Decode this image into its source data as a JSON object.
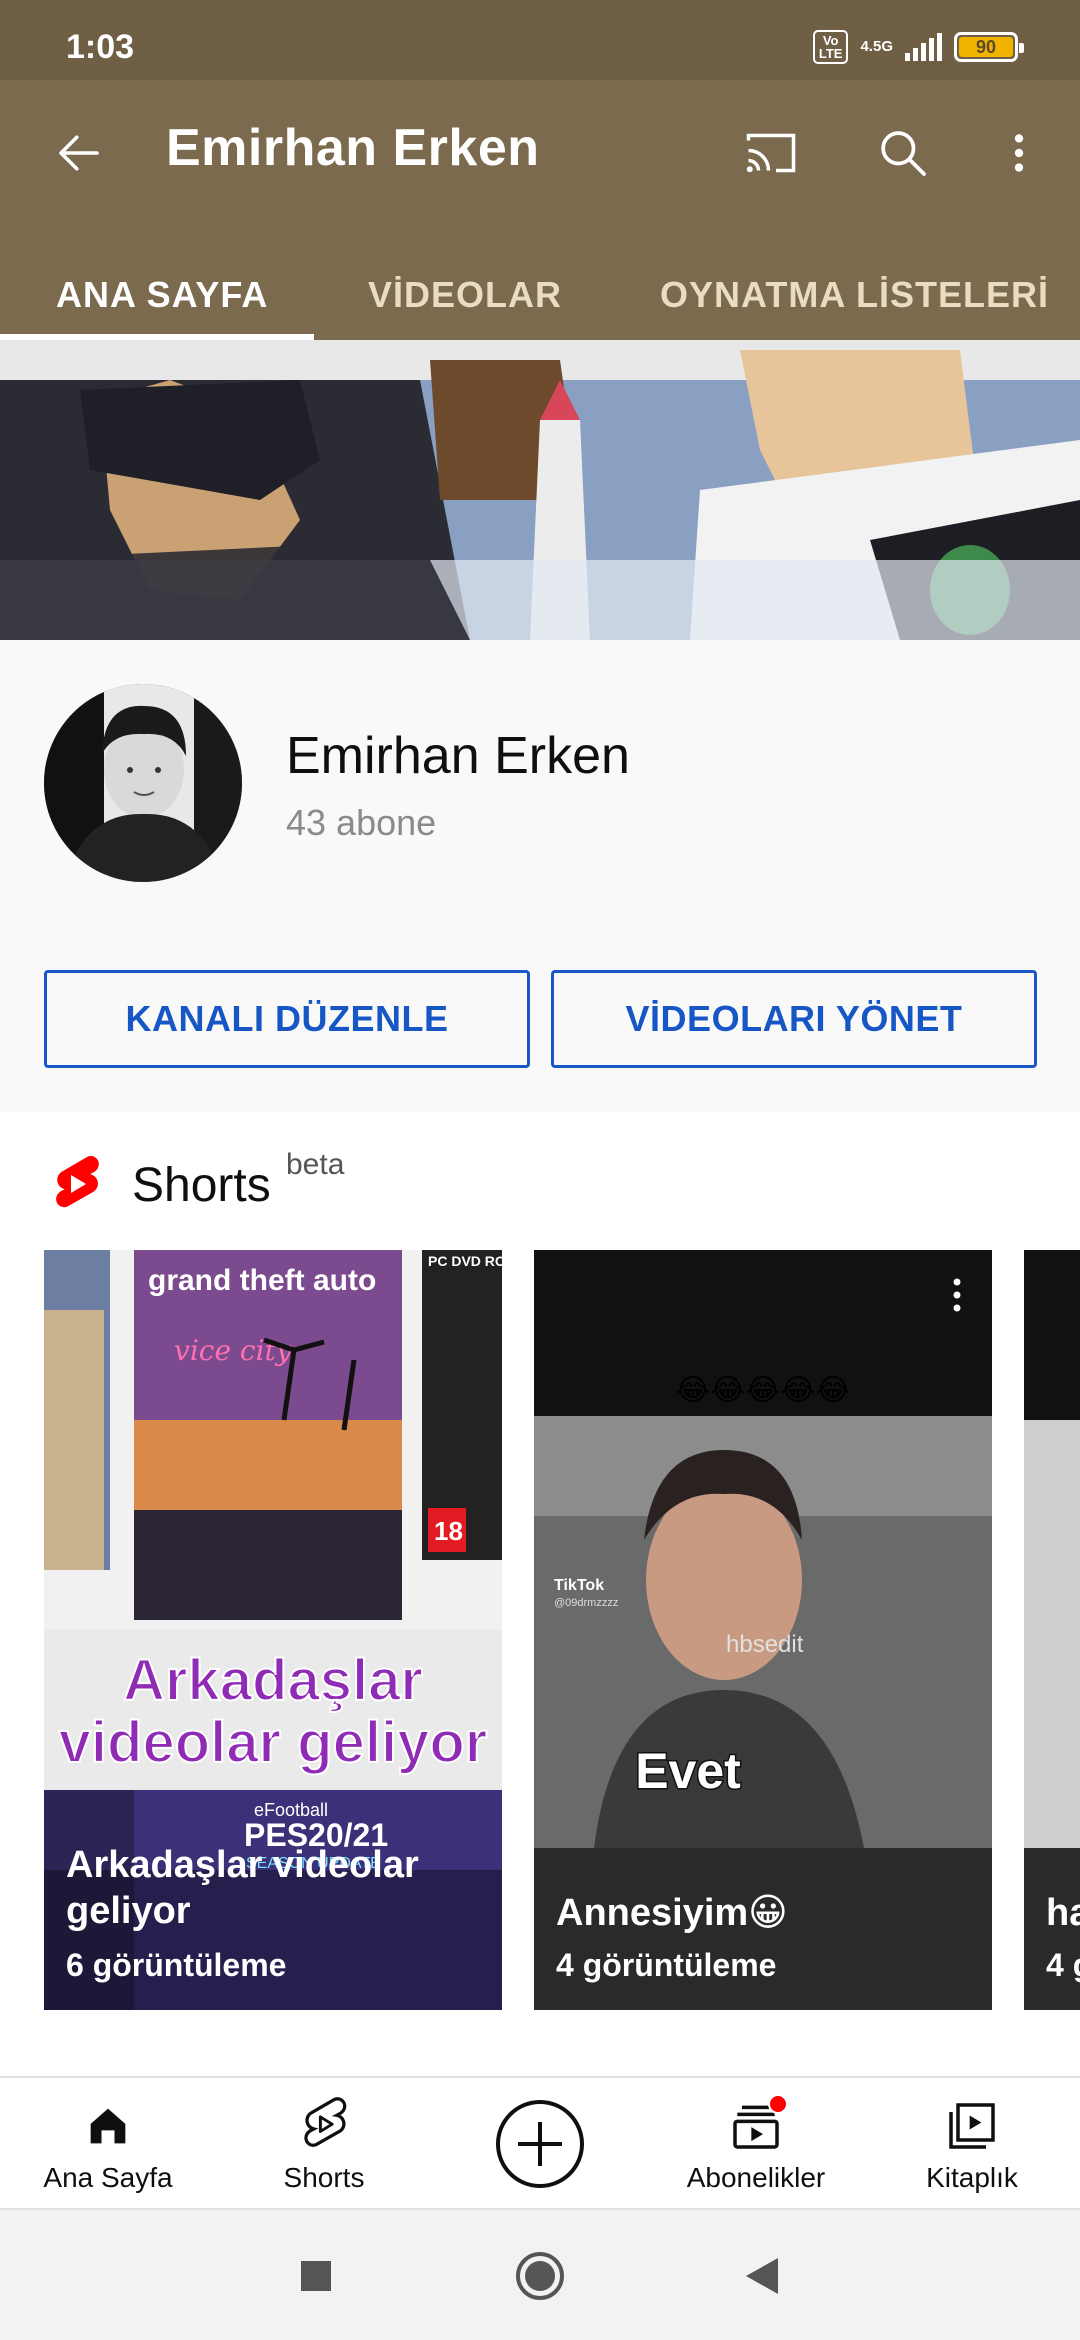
{
  "status_bar": {
    "time": "1:03",
    "volte": "Vo LTE",
    "network": "4.5G",
    "battery": "90"
  },
  "app_bar": {
    "title": "Emirhan Erken",
    "tabs": [
      {
        "label": "ANA SAYFA",
        "active": true
      },
      {
        "label": "VİDEOLAR",
        "active": false
      },
      {
        "label": "OYNATMA LİSTELERİ",
        "active": false
      }
    ]
  },
  "channel": {
    "name": "Emirhan Erken",
    "subscribers": "43 abone",
    "edit_button": "KANALI DÜZENLE",
    "manage_button": "VİDEOLARI YÖNET"
  },
  "shorts": {
    "title": "Shorts",
    "badge": "beta",
    "cards": [
      {
        "title_line1": "Arkadaşlar videolar",
        "title_line2": "geliyor",
        "views": "6 görüntüleme",
        "thumb_text_1": "Arkadaşlar",
        "thumb_text_2": "videolar geliyor",
        "thumb_gta": "grand theft auto",
        "thumb_vice": "vice city",
        "thumb_pes": "PES20/21",
        "thumb_pes_sub": "SEASON UPDATE",
        "thumb_efootball": "eFootball",
        "thumb_rating": "18",
        "thumb_pc": "PC DVD ROM"
      },
      {
        "title": "Annesiyim😀",
        "views": "4 görüntüleme",
        "thumb_emojis": "😂😂😂😂😂",
        "thumb_caption": "Evet",
        "thumb_watermark": "hbsedit",
        "thumb_tiktok": "TikTok",
        "thumb_tiktok_user": "@09drmzzzz"
      },
      {
        "title": "ha",
        "views": "4 g"
      }
    ]
  },
  "bottom_nav": [
    {
      "label": "Ana Sayfa",
      "icon": "home-icon"
    },
    {
      "label": "Shorts",
      "icon": "shorts-icon"
    },
    {
      "label": "",
      "icon": "create-icon"
    },
    {
      "label": "Abonelikler",
      "icon": "subscriptions-icon"
    },
    {
      "label": "Kitaplık",
      "icon": "library-icon"
    }
  ],
  "colors": {
    "status_bar": "#6f5f44",
    "app_bar": "#7b6a4d",
    "accent_blue": "#1656c5",
    "shorts_red": "#ff0000"
  }
}
